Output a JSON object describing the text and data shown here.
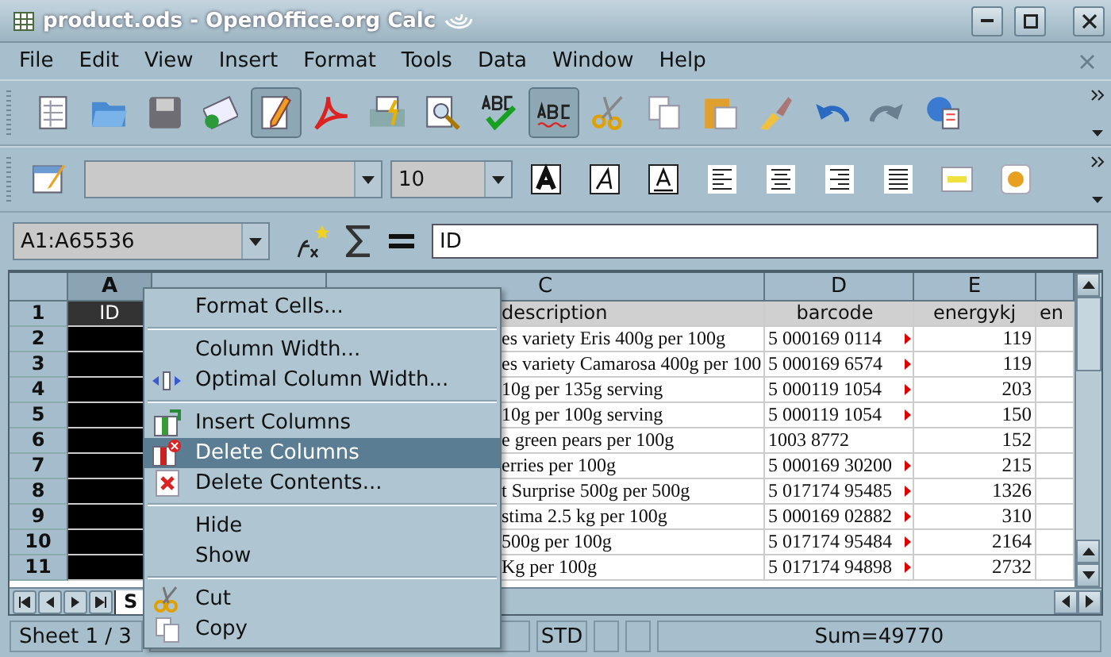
{
  "window": {
    "title": "product.ods - OpenOffice.org Calc"
  },
  "menubar": [
    "File",
    "Edit",
    "View",
    "Insert",
    "Format",
    "Tools",
    "Data",
    "Window",
    "Help"
  ],
  "toolbar_standard": [
    {
      "kind": "new",
      "pressed": false
    },
    {
      "kind": "open",
      "pressed": false
    },
    {
      "kind": "save",
      "pressed": false
    },
    {
      "kind": "mail",
      "pressed": false
    },
    {
      "kind": "edit",
      "pressed": true
    },
    {
      "kind": "pdf",
      "pressed": false
    },
    {
      "kind": "print",
      "pressed": false
    },
    {
      "kind": "preview",
      "pressed": false
    },
    {
      "kind": "spell",
      "pressed": false
    },
    {
      "kind": "autospell",
      "pressed": true
    },
    {
      "kind": "cut",
      "pressed": false
    },
    {
      "kind": "copy",
      "pressed": false
    },
    {
      "kind": "paste",
      "pressed": false
    },
    {
      "kind": "brush",
      "pressed": false
    },
    {
      "kind": "undo",
      "pressed": false
    },
    {
      "kind": "redo",
      "pressed": false
    },
    {
      "kind": "navigator",
      "pressed": false
    }
  ],
  "toolbar_formatting": {
    "font_size": "10",
    "buttons": [
      {
        "kind": "bold",
        "pressed": false
      },
      {
        "kind": "italic",
        "pressed": false
      },
      {
        "kind": "underline",
        "pressed": false
      },
      {
        "kind": "align-left",
        "pressed": false
      },
      {
        "kind": "align-center",
        "pressed": false
      },
      {
        "kind": "align-right",
        "pressed": false
      },
      {
        "kind": "justify",
        "pressed": false
      },
      {
        "kind": "merge",
        "pressed": false
      },
      {
        "kind": "currency",
        "pressed": false
      }
    ]
  },
  "formula_bar": {
    "name_box": "A1:A65536",
    "content": "ID"
  },
  "grid": {
    "columns": [
      {
        "label": "A",
        "selected": true
      },
      {
        "selected": false
      },
      {
        "label": "C",
        "selected": false
      },
      {
        "label": "D",
        "selected": false
      },
      {
        "label": "E",
        "selected": false
      },
      {
        "selected": false
      }
    ],
    "rows": [
      {
        "row": "1",
        "a": "ID",
        "c": "description",
        "d": "barcode",
        "e": "energykj",
        "f": "en",
        "d_overflow": false
      },
      {
        "row": "2",
        "c": "es variety Eris 400g per 100g",
        "d": "5 000169 0114",
        "e": "119",
        "d_overflow": true
      },
      {
        "row": "3",
        "c": "es variety Camarosa 400g per 100",
        "d": "5 000169 6574",
        "e": "119",
        "d_overflow": true
      },
      {
        "row": "4",
        "c": "10g per 135g serving",
        "d": "5 000119 1054",
        "e": "203",
        "d_overflow": true
      },
      {
        "row": "5",
        "c": "10g per 100g serving",
        "d": "5 000119 1054",
        "e": "150",
        "d_overflow": true
      },
      {
        "row": "6",
        "c": "e green pears per 100g",
        "d": "1003 8772",
        "e": "152",
        "d_overflow": false
      },
      {
        "row": "7",
        "c": "erries per 100g",
        "d": "5 000169 30200",
        "e": "215",
        "d_overflow": true
      },
      {
        "row": "8",
        "c": "t Surprise 500g per 500g",
        "d": "5 017174 95485",
        "e": "1326",
        "d_overflow": true
      },
      {
        "row": "9",
        "c": "stima 2.5 kg per 100g",
        "d": "5 000169 02882",
        "e": "310",
        "d_overflow": true
      },
      {
        "row": "10",
        "c": "500g per 100g",
        "d": "5 017174 95484",
        "e": "2164",
        "d_overflow": true
      },
      {
        "row": "11",
        "c": "Kg per 100g",
        "d": "5 017174 94898",
        "e": "2732",
        "d_overflow": true
      }
    ]
  },
  "sheet_tabs": [
    {
      "label": "S",
      "selected": true
    }
  ],
  "context_menu": [
    {
      "kind": "plain",
      "label": "Format Cells...",
      "selected": false
    },
    {
      "kind": "separator"
    },
    {
      "kind": "plain",
      "label": "Column Width...",
      "selected": false
    },
    {
      "kind": "width",
      "label": "Optimal Column Width...",
      "selected": false
    },
    {
      "kind": "separator"
    },
    {
      "kind": "insert",
      "label": "Insert Columns",
      "selected": false
    },
    {
      "kind": "remove",
      "label": "Delete Columns",
      "selected": true
    },
    {
      "kind": "clear",
      "label": "Delete Contents...",
      "selected": false
    },
    {
      "kind": "separator"
    },
    {
      "kind": "plain",
      "label": "Hide",
      "selected": false
    },
    {
      "kind": "plain",
      "label": "Show",
      "selected": false
    },
    {
      "kind": "separator"
    },
    {
      "kind": "cut",
      "label": "Cut",
      "selected": false
    },
    {
      "kind": "copy",
      "label": "Copy",
      "selected": false
    }
  ],
  "status_bar": {
    "sheet": "Sheet 1 / 3",
    "mode": "STD",
    "sum": "Sum=49770"
  }
}
